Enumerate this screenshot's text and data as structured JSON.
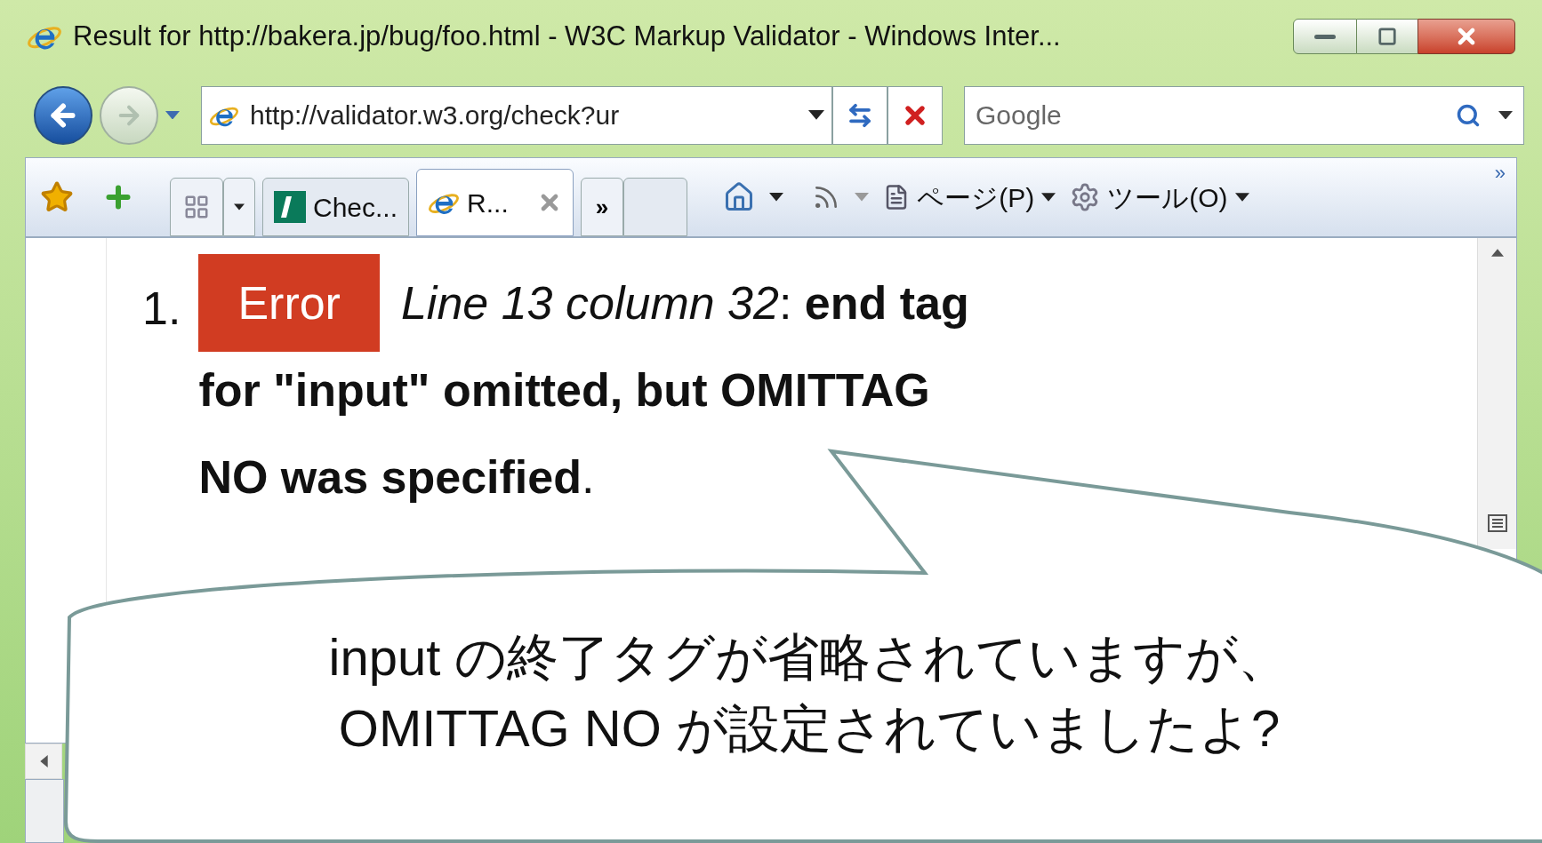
{
  "window": {
    "title": "Result for http://bakera.jp/bug/foo.html - W3C Markup Validator - Windows Inter..."
  },
  "address_bar": {
    "value": "http://validator.w3.org/check?ur"
  },
  "search": {
    "placeholder": "Google"
  },
  "tabs": [
    {
      "label": "Chec...",
      "selected": false,
      "kind": "validator"
    },
    {
      "label": "R...",
      "selected": true,
      "kind": "ie"
    }
  ],
  "tab_overflow": "»",
  "command_bar": [
    {
      "label": "ページ(P)",
      "kind": "page"
    },
    {
      "label": "ツール(O)",
      "kind": "tools"
    }
  ],
  "command_overflow": "»",
  "content": {
    "number": "1.",
    "badge": "Error",
    "message_lines": [
      "*Line 13 column 32*: **end tag**",
      "**for \"input\" omitted, but OMITTAG**",
      "**NO was specified**."
    ]
  },
  "callout": {
    "lines": [
      "input の終了タグが省略されていますが、",
      "OMITTAG NO が設定されていましたよ?"
    ]
  }
}
